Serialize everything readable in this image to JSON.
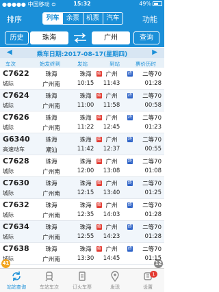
{
  "status": {
    "carrier": "●●●●● 中国移动 ⊜",
    "time": "15:32",
    "battery": "49%"
  },
  "nav": {
    "left": "排序",
    "right": "功能",
    "segments": [
      "列车",
      "余票",
      "机票",
      "汽车"
    ]
  },
  "route": {
    "history": "历史",
    "from": "珠海",
    "to": "广州",
    "query": "查询"
  },
  "date": {
    "label": "乘车日期:2017-08-17(星期四)",
    "prev": "◀",
    "next": "▶"
  },
  "columns": [
    "车次",
    "始发终到",
    "发站",
    "到站",
    "票价历时"
  ],
  "trains": [
    {
      "no": "C7622",
      "type": "城际",
      "from": "珠海",
      "to": "广州南",
      "depart": "10:15",
      "arrive": "11:43",
      "seat": "二等",
      "price": "二等70",
      "duration": "01:28",
      "alt": false
    },
    {
      "no": "C7624",
      "type": "城际",
      "from": "珠海",
      "to": "广州南",
      "depart": "11:00",
      "arrive": "11:58",
      "seat": "",
      "price": "二等70",
      "duration": "00:58",
      "alt": true
    },
    {
      "no": "C7626",
      "type": "城际",
      "from": "珠海",
      "to": "广州南",
      "depart": "11:22",
      "arrive": "12:45",
      "seat": "",
      "price": "二等70",
      "duration": "01:23",
      "alt": false
    },
    {
      "no": "G6340",
      "type": "高速动车",
      "from": "珠海",
      "to": "潮汕",
      "depart": "11:42",
      "arrive": "12:37",
      "seat": "",
      "price": "二等70",
      "duration": "00:55",
      "alt": true
    },
    {
      "no": "C7628",
      "type": "城际",
      "from": "珠海",
      "to": "广州南",
      "depart": "12:00",
      "arrive": "13:08",
      "seat": "",
      "price": "二等70",
      "duration": "01:08",
      "alt": false
    },
    {
      "no": "C7630",
      "type": "城际",
      "from": "珠海",
      "to": "广州南",
      "depart": "12:15",
      "arrive": "13:40",
      "seat": "",
      "price": "二等70",
      "duration": "01:25",
      "alt": true
    },
    {
      "no": "C7632",
      "type": "城际",
      "from": "珠海",
      "to": "广州南",
      "depart": "12:35",
      "arrive": "14:03",
      "seat": "",
      "price": "二等70",
      "duration": "01:28",
      "alt": false
    },
    {
      "no": "C7634",
      "type": "城际",
      "from": "珠海",
      "to": "广州南",
      "depart": "12:55",
      "arrive": "14:23",
      "seat": "",
      "price": "二等70",
      "duration": "01:28",
      "alt": true
    },
    {
      "no": "C7638",
      "type": "城际",
      "from": "珠海",
      "to": "广州南",
      "depart": "13:30",
      "arrive": "14:45",
      "seat": "",
      "price": "二等70",
      "duration": "01:15",
      "alt": false
    }
  ],
  "badges": {
    "start": "始",
    "end": "终"
  },
  "floating": {
    "left": "41",
    "right": "12"
  },
  "tabs": [
    {
      "label": "站站查询",
      "active": true,
      "icon": "refresh-icon"
    },
    {
      "label": "车站车次",
      "active": false,
      "icon": "train-icon"
    },
    {
      "label": "订火车票",
      "active": false,
      "icon": "ticket-icon"
    },
    {
      "label": "发现",
      "active": false,
      "icon": "location-icon"
    },
    {
      "label": "设置",
      "active": false,
      "icon": "gear-icon",
      "badge": "1"
    }
  ],
  "colors": {
    "primary": "#1a8fd8",
    "badge_start": "#e33b32",
    "badge_end": "#2f64c8",
    "float_left": "#f2a41e"
  }
}
